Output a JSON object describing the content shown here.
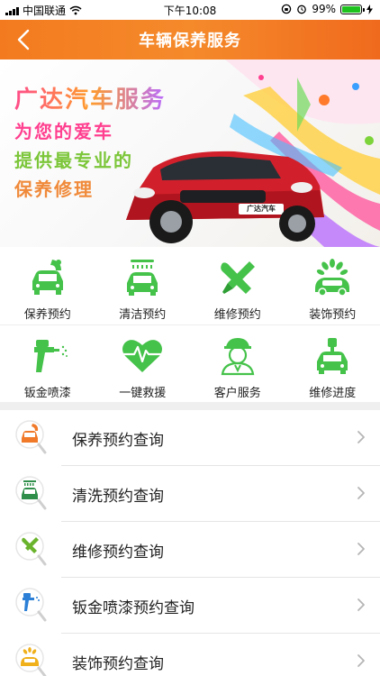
{
  "status_bar": {
    "carrier": "中国联通",
    "time": "下午10:08",
    "battery_percent": "99%",
    "battery_level": 0.99,
    "icons": [
      "signal-icon",
      "wifi-icon",
      "orientation-lock-icon",
      "alarm-icon",
      "battery-icon",
      "charging-icon"
    ]
  },
  "nav": {
    "title": "车辆保养服务",
    "back_icon": "chevron-left-icon"
  },
  "banner": {
    "line1": "广达汽车服务",
    "line2": "为您的爱车",
    "line3": "提供最专业的",
    "line4": "保养修理",
    "plate": "广达汽车"
  },
  "grid": {
    "items": [
      {
        "label": "保养预约",
        "icon": "car-maintenance-icon"
      },
      {
        "label": "清洁预约",
        "icon": "car-wash-icon"
      },
      {
        "label": "维修预约",
        "icon": "wrench-screwdriver-icon"
      },
      {
        "label": "装饰预约",
        "icon": "car-decoration-icon"
      },
      {
        "label": "钣金喷漆",
        "icon": "spray-gun-icon"
      },
      {
        "label": "一键救援",
        "icon": "heartbeat-icon"
      },
      {
        "label": "客户服务",
        "icon": "customer-service-icon"
      },
      {
        "label": "维修进度",
        "icon": "repair-progress-icon"
      }
    ],
    "icon_color": "#45c24a"
  },
  "list": {
    "items": [
      {
        "label": "保养预约查询",
        "icon": "maintenance-query-icon",
        "color": "#f07a2a"
      },
      {
        "label": "清洗预约查询",
        "icon": "wash-query-icon",
        "color": "#2f8f4a"
      },
      {
        "label": "维修预约查询",
        "icon": "repair-query-icon",
        "color": "#6ab32c"
      },
      {
        "label": "钣金喷漆预约查询",
        "icon": "paint-query-icon",
        "color": "#2b7fd6"
      },
      {
        "label": "装饰预约查询",
        "icon": "decoration-query-icon",
        "color": "#f0b01a"
      }
    ]
  },
  "colors": {
    "nav_orange": "#f37a1f",
    "green": "#45c24a"
  }
}
